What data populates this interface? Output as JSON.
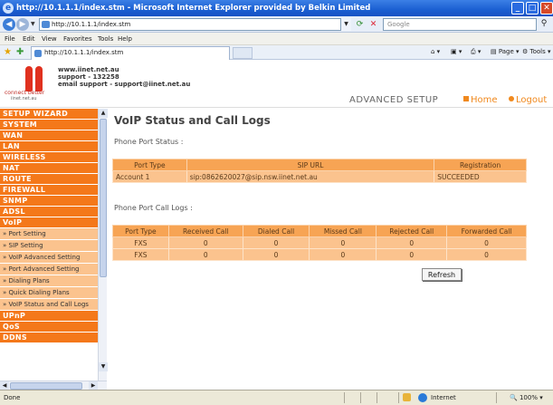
{
  "window": {
    "title": "http://10.1.1.1/index.stm - Microsoft Internet Explorer provided by Belkin Limited"
  },
  "addressbar": {
    "url": "http://10.1.1.1/index.stm",
    "search_placeholder": "Google"
  },
  "menu": [
    "File",
    "Edit",
    "View",
    "Favorites",
    "Tools",
    "Help"
  ],
  "toolbar": {
    "tab_label": "http://10.1.1.1/index.stm",
    "page_label": "Page",
    "tools_label": "Tools"
  },
  "header": {
    "logo_tagline": "connect better",
    "logo_url": "iinet.net.au",
    "contact_line1": "www.iinet.net.au",
    "contact_line2": "support - 132258",
    "contact_line3": "email support - support@iinet.net.au",
    "advanced_setup": "ADVANCED SETUP",
    "home_link": "Home",
    "logout_link": "Logout"
  },
  "sidebar": {
    "items": [
      {
        "label": "SETUP WIZARD",
        "type": "main"
      },
      {
        "label": "SYSTEM",
        "type": "main"
      },
      {
        "label": "WAN",
        "type": "main"
      },
      {
        "label": "LAN",
        "type": "main"
      },
      {
        "label": "WIRELESS",
        "type": "main"
      },
      {
        "label": "NAT",
        "type": "main"
      },
      {
        "label": "ROUTE",
        "type": "main"
      },
      {
        "label": "FIREWALL",
        "type": "main"
      },
      {
        "label": "SNMP",
        "type": "main"
      },
      {
        "label": "ADSL",
        "type": "main"
      },
      {
        "label": "VoIP",
        "type": "main"
      },
      {
        "label": "» Port Setting",
        "type": "sub"
      },
      {
        "label": "» SIP Setting",
        "type": "sub"
      },
      {
        "label": "» VoIP Advanced Setting",
        "type": "sub"
      },
      {
        "label": "» Port Advanced Setting",
        "type": "sub"
      },
      {
        "label": "» Dialing Plans",
        "type": "sub"
      },
      {
        "label": "» Quick Dialing Plans",
        "type": "sub"
      },
      {
        "label": "» VoIP Status and Call Logs",
        "type": "sub"
      },
      {
        "label": "UPnP",
        "type": "main"
      },
      {
        "label": "QoS",
        "type": "main"
      },
      {
        "label": "DDNS",
        "type": "main"
      }
    ]
  },
  "main": {
    "title": "VoIP Status and Call Logs",
    "phone_port_status_label": "Phone Port Status :",
    "status_table": {
      "headers": [
        "Port Type",
        "SIP URL",
        "Registration"
      ],
      "rows": [
        [
          "Account 1",
          "sip:0862620027@sip.nsw.iinet.net.au",
          "SUCCEEDED"
        ]
      ]
    },
    "call_logs_label": "Phone Port Call Logs :",
    "logs_table": {
      "headers": [
        "Port Type",
        "Received Call",
        "Dialed Call",
        "Missed Call",
        "Rejected Call",
        "Forwarded Call"
      ],
      "rows": [
        [
          "FXS",
          "0",
          "0",
          "0",
          "0",
          "0"
        ],
        [
          "FXS",
          "0",
          "0",
          "0",
          "0",
          "0"
        ]
      ]
    },
    "refresh_label": "Refresh"
  },
  "statusbar": {
    "status": "Done",
    "zone": "Internet",
    "zoom": "100%"
  }
}
